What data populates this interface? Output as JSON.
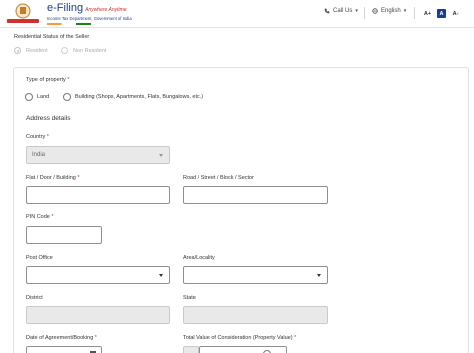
{
  "header": {
    "brand_title": "e-Filing",
    "brand_tagline": "Anywhere Anytime",
    "brand_dept": "Income Tax Department, Government of India",
    "call_us": "Call Us",
    "language": "English",
    "font_increase": "A+",
    "font_default": "A",
    "font_decrease": "A-"
  },
  "residential": {
    "label": "Residential Status of the Seller",
    "options": [
      "Resident",
      "Non Resident"
    ]
  },
  "form": {
    "property_type_label": "Type of property",
    "property_options": [
      "Land",
      "Building (Shops, Apartments, Flats, Bungalows, etc.)"
    ],
    "address_heading": "Address details",
    "country_label": "Country",
    "country_value": "India",
    "flat_label": "Flat / Door / Building",
    "road_label": "Road / Street / Block / Sector",
    "pin_label": "PIN Code",
    "post_office_label": "Post Office",
    "area_label": "Area/Locality",
    "district_label": "District",
    "state_label": "State",
    "agreement_date_label": "Date of Agreement/Booking",
    "total_value_label": "Total Value of Consideration (Property Value)",
    "required_mark": "*"
  },
  "colors": {
    "brand_blue": "#1a3d8f",
    "required_red": "#d0312d",
    "disabled_bg": "#e9e9e9"
  }
}
